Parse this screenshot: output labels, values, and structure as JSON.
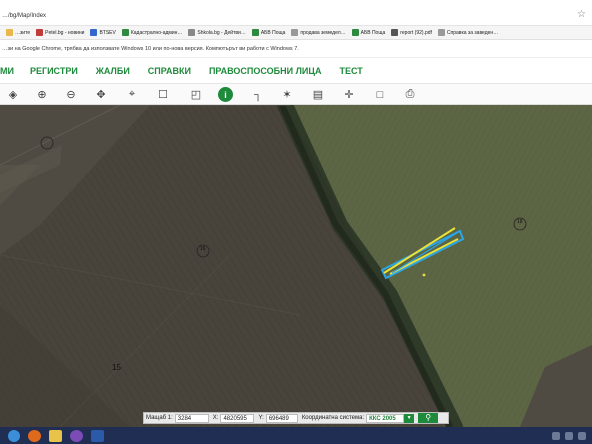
{
  "browser": {
    "url": "…/bg/Map/Index",
    "bookmarks": [
      {
        "label": "…зите",
        "icon": "folder-icon",
        "color": "#e8b84a"
      },
      {
        "label": "Petel.bg - новини",
        "icon": "site-icon",
        "color": "#c23b3b"
      },
      {
        "label": "BTSEV",
        "icon": "site-icon",
        "color": "#3366cc"
      },
      {
        "label": "Кадастрално-админ…",
        "icon": "site-icon",
        "color": "#2d8a3e"
      },
      {
        "label": "Shkola.bg - Дейтви…",
        "icon": "site-icon",
        "color": "#888888"
      },
      {
        "label": "АБВ Поща",
        "icon": "mail-icon",
        "color": "#2d8a3e"
      },
      {
        "label": "продава земедел…",
        "icon": "site-icon",
        "color": "#999999"
      },
      {
        "label": "АБВ Поща",
        "icon": "mail-icon",
        "color": "#2d8a3e"
      },
      {
        "label": "report (92).pdf",
        "icon": "pdf-icon",
        "color": "#555555"
      },
      {
        "label": "Справка за заведен…",
        "icon": "site-icon",
        "color": "#999999"
      }
    ]
  },
  "notice": "…зи на Google Chrome, трябва да използвате Windows 10 или по-нова версия. Компютърът ви работи с Windows 7.",
  "nav": {
    "items": [
      {
        "label": "МИ",
        "name": "menu-item-mi"
      },
      {
        "label": "РЕГИСТРИ",
        "name": "menu-item-registers"
      },
      {
        "label": "ЖАЛБИ",
        "name": "menu-item-complaints"
      },
      {
        "label": "СПРАВКИ",
        "name": "menu-item-reports"
      },
      {
        "label": "ПРАВОСПОСОБНИ ЛИЦА",
        "name": "menu-item-legal-entities"
      },
      {
        "label": "ТЕСТ",
        "name": "menu-item-test"
      }
    ]
  },
  "toolbar": {
    "tools": [
      {
        "name": "layers-icon",
        "glyph": "◈"
      },
      {
        "name": "zoom-in-icon",
        "glyph": "⊕"
      },
      {
        "name": "zoom-out-icon",
        "glyph": "⊖"
      },
      {
        "name": "pan-icon",
        "glyph": "✥"
      },
      {
        "name": "location-pin-icon",
        "glyph": "⌖"
      },
      {
        "name": "select-rectangle-icon",
        "glyph": "☐"
      },
      {
        "name": "select-area-icon",
        "glyph": "◰"
      },
      {
        "name": "info-icon",
        "glyph": "i",
        "active": true
      },
      {
        "name": "measure-distance-icon",
        "glyph": "┐"
      },
      {
        "name": "measure-area-icon",
        "glyph": "✶"
      },
      {
        "name": "map-icon",
        "glyph": "▤"
      },
      {
        "name": "coordinates-icon",
        "glyph": "✛"
      },
      {
        "name": "document-icon",
        "glyph": "□"
      },
      {
        "name": "print-icon",
        "glyph": "⎙"
      }
    ]
  },
  "map": {
    "parcel_labels": [
      {
        "text": "15",
        "name": "parcel-label-15"
      },
      {
        "text": "16",
        "name": "parcel-label-16"
      },
      {
        "text": "18",
        "name": "parcel-label-18"
      }
    ]
  },
  "status": {
    "scale_label": "Мащаб 1:",
    "scale_value": "3284",
    "x_label": "X:",
    "x_value": "4820595",
    "y_label": "Y:",
    "y_value": "696489",
    "system_label": "Координатна система:",
    "system_value": "ККС 2005"
  },
  "colors": {
    "accent": "#1e8a3b",
    "parcel_outline_blue": "#2aa6e8",
    "parcel_outline_yellow": "#e8e23a"
  }
}
